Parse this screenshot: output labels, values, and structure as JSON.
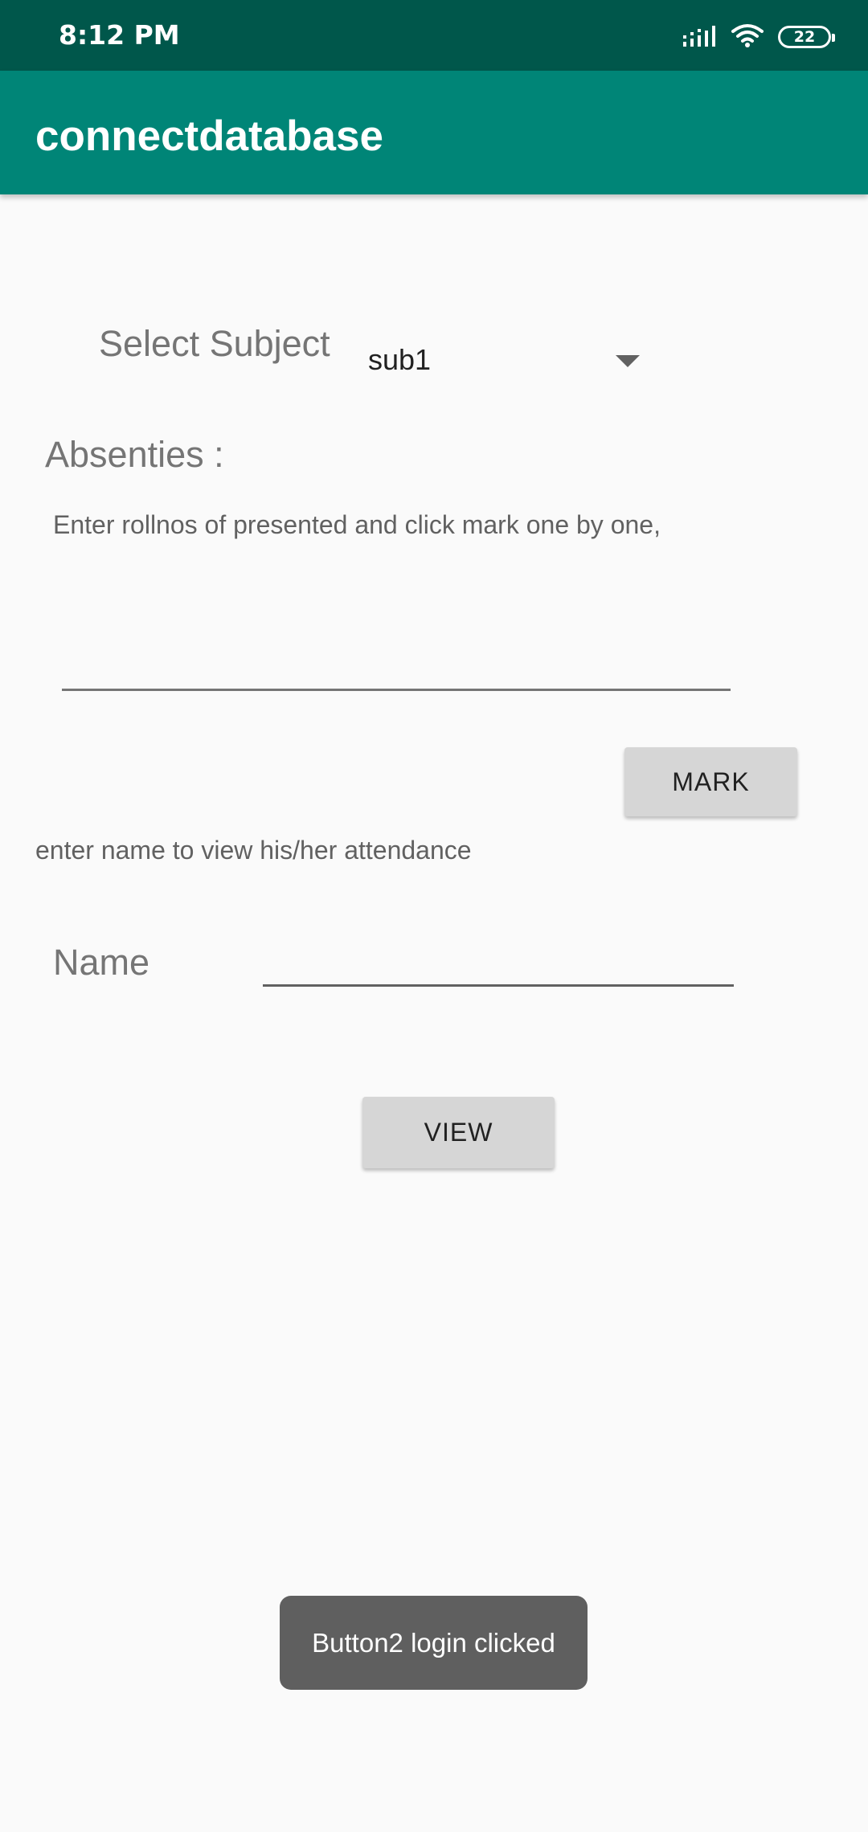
{
  "status_bar": {
    "time": "8:12 PM",
    "battery_level": "22",
    "icons": [
      "signal-icon",
      "wifi-icon",
      "battery-icon"
    ]
  },
  "app_bar": {
    "title": "connectdatabase"
  },
  "subject": {
    "label": "Select Subject",
    "selected_value": "sub1"
  },
  "absentees": {
    "label": "Absenties :",
    "hint": "Enter rollnos of presented and click mark one by one,",
    "input_value": "",
    "mark_button": "MARK"
  },
  "view_attendance": {
    "hint": "enter name to view his/her attendance",
    "name_label": "Name",
    "name_value": "",
    "view_button": "VIEW"
  },
  "toast": {
    "message": "Button2 login clicked"
  },
  "colors": {
    "status_bar": "#00574b",
    "app_bar": "#008577",
    "background": "#fafafa",
    "button": "#d6d6d6",
    "toast": "#5f5f5f"
  }
}
